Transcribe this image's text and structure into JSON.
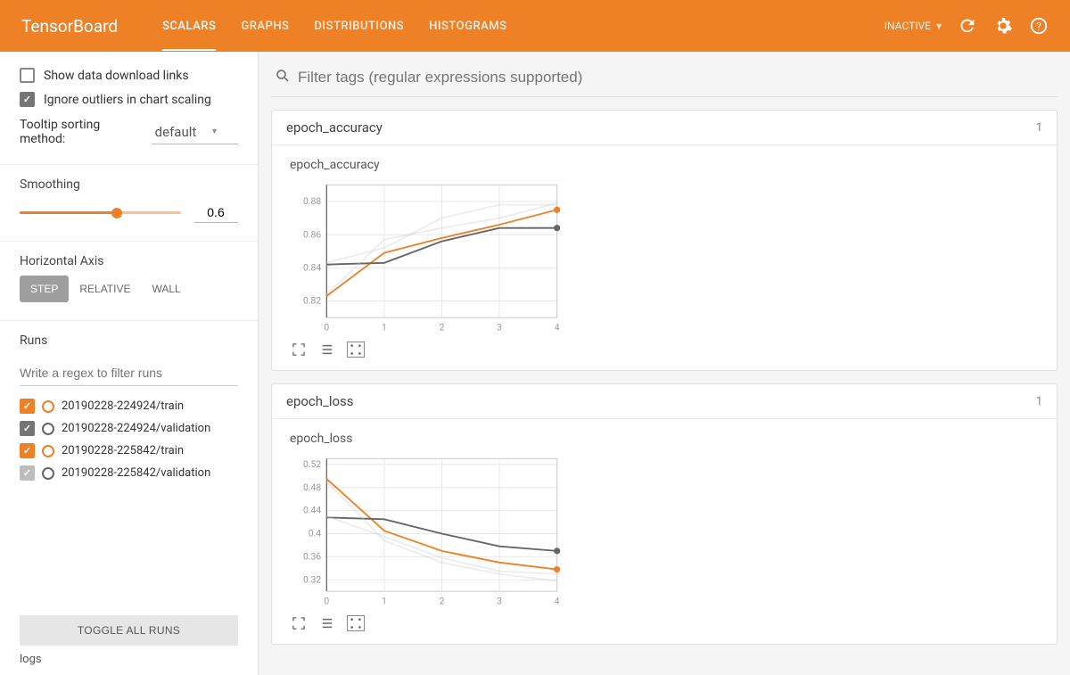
{
  "header": {
    "logo": "TensorBoard",
    "tabs": [
      "SCALARS",
      "GRAPHS",
      "DISTRIBUTIONS",
      "HISTOGRAMS"
    ],
    "active_tab": 0,
    "inactive_label": "INACTIVE"
  },
  "sidebar": {
    "show_download_label": "Show data download links",
    "show_download_checked": false,
    "ignore_outliers_label": "Ignore outliers in chart scaling",
    "ignore_outliers_checked": true,
    "tooltip_sort_label": "Tooltip sorting method:",
    "tooltip_sort_value": "default",
    "smoothing_label": "Smoothing",
    "smoothing_value": "0.6",
    "smoothing_percent": 60,
    "horizontal_axis_label": "Horizontal Axis",
    "axis_options": [
      "STEP",
      "RELATIVE",
      "WALL"
    ],
    "axis_active": 0,
    "runs_label": "Runs",
    "runs_filter_placeholder": "Write a regex to filter runs",
    "runs": [
      {
        "name": "20190228-224924/train",
        "color": "#ee8125",
        "swatch_border": "#ee8125",
        "checked": true,
        "check_bg": "#ee8125"
      },
      {
        "name": "20190228-224924/validation",
        "color": "#666",
        "swatch_border": "#666",
        "checked": true,
        "check_bg": "#757575"
      },
      {
        "name": "20190228-225842/train",
        "color": "#ee8125",
        "swatch_border": "#ee8125",
        "checked": true,
        "check_bg": "#ee8125"
      },
      {
        "name": "20190228-225842/validation",
        "color": "#666",
        "swatch_border": "#666",
        "checked": true,
        "check_bg": "#bdbdbd"
      }
    ],
    "toggle_all_label": "TOGGLE ALL RUNS",
    "logs_label": "logs"
  },
  "content": {
    "filter_placeholder": "Filter tags (regular expressions supported)",
    "panels": [
      {
        "title": "epoch_accuracy",
        "count": "1",
        "chart_title": "epoch_accuracy"
      },
      {
        "title": "epoch_loss",
        "count": "1",
        "chart_title": "epoch_loss"
      }
    ]
  },
  "chart_data": [
    {
      "type": "line",
      "title": "epoch_accuracy",
      "x": [
        0,
        1,
        2,
        3,
        4
      ],
      "ylim": [
        0.81,
        0.89
      ],
      "y_ticks": [
        0.82,
        0.84,
        0.86,
        0.88
      ],
      "x_ticks": [
        0,
        1,
        2,
        3,
        4
      ],
      "series": [
        {
          "name": "20190228-224924/train",
          "color": "#ee8125",
          "values": [
            0.823,
            0.849,
            0.858,
            0.866,
            0.875
          ],
          "faded": false
        },
        {
          "name": "20190228-224924/validation",
          "color": "#666",
          "values": [
            0.842,
            0.843,
            0.856,
            0.864,
            0.864
          ],
          "faded": false
        },
        {
          "name": "20190228-225842/train",
          "color": "#ccc",
          "values": [
            0.824,
            0.857,
            0.864,
            0.87,
            0.879
          ],
          "faded": true
        },
        {
          "name": "20190228-225842/validation",
          "color": "#ccc",
          "values": [
            0.843,
            0.852,
            0.87,
            0.878,
            0.878
          ],
          "faded": true
        }
      ]
    },
    {
      "type": "line",
      "title": "epoch_loss",
      "x": [
        0,
        1,
        2,
        3,
        4
      ],
      "ylim": [
        0.3,
        0.53
      ],
      "y_ticks": [
        0.32,
        0.36,
        0.4,
        0.44,
        0.48,
        0.52
      ],
      "x_ticks": [
        0,
        1,
        2,
        3,
        4
      ],
      "series": [
        {
          "name": "20190228-224924/train",
          "color": "#ee8125",
          "values": [
            0.495,
            0.405,
            0.37,
            0.35,
            0.338
          ],
          "faded": false
        },
        {
          "name": "20190228-224924/validation",
          "color": "#666",
          "values": [
            0.428,
            0.425,
            0.4,
            0.378,
            0.37
          ],
          "faded": false
        },
        {
          "name": "20190228-225842/train",
          "color": "#ccc",
          "values": [
            0.49,
            0.388,
            0.35,
            0.33,
            0.318
          ],
          "faded": true
        },
        {
          "name": "20190228-225842/validation",
          "color": "#ccc",
          "values": [
            0.43,
            0.395,
            0.358,
            0.335,
            0.33
          ],
          "faded": true
        }
      ]
    }
  ]
}
